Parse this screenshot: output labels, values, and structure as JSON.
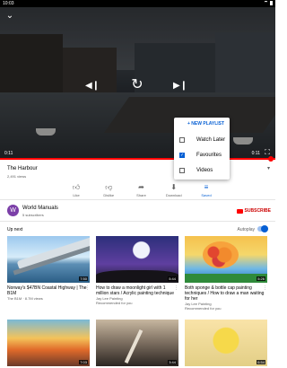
{
  "status_bar": {
    "time": "10:03"
  },
  "player": {
    "current_time": "0:11",
    "duration": "0:11",
    "progress_fraction": 1.0
  },
  "playlist_popup": {
    "new_playlist": "+ NEW PLAYLIST",
    "items": [
      {
        "label": "Watch Later",
        "checked": false
      },
      {
        "label": "Favourites",
        "checked": true
      },
      {
        "label": "Videos",
        "checked": false
      }
    ]
  },
  "video": {
    "title": "The Harbour",
    "views": "2,491 views"
  },
  "actions": [
    {
      "label": "Like",
      "icon": "thumbs-up-icon"
    },
    {
      "label": "Dislike",
      "icon": "thumbs-down-icon"
    },
    {
      "label": "Share",
      "icon": "share-icon"
    },
    {
      "label": "Download",
      "icon": "download-icon"
    },
    {
      "label": "Saved",
      "icon": "playlist-add-check-icon"
    }
  ],
  "channel": {
    "avatar_letter": "W",
    "name": "World Manuals",
    "subscribers": "5 subscribers",
    "subscribe_label": "SUBSCRIBE"
  },
  "up_next": {
    "label": "Up next",
    "autoplay_label": "Autoplay",
    "autoplay_on": true,
    "videos": [
      {
        "title": "Norway's $47BN Coastal Highway | The B1M",
        "meta1": "The B1M · 8.7M views",
        "meta2": "",
        "duration": "7:50"
      },
      {
        "title": "How to draw a moonlight girl with 1 million stars / Acrylic painting technique",
        "meta1": "Jay Lee Painting",
        "meta2": "Recommended for you",
        "duration": "5:44"
      },
      {
        "title": "Both sponge & bottle cap painting techniques / How to draw a man waiting for her",
        "meta1": "Jay Lee Painting",
        "meta2": "Recommended for you",
        "duration": "5:26"
      },
      {
        "title": "",
        "meta1": "",
        "meta2": "",
        "duration": "7:03"
      },
      {
        "title": "",
        "meta1": "",
        "meta2": "",
        "duration": "3:44"
      },
      {
        "title": "",
        "meta1": "",
        "meta2": "",
        "duration": "6:54"
      }
    ]
  },
  "colors": {
    "accent": "#065fd4",
    "progress": "#ff0000",
    "subscribe": "#cc0000"
  }
}
